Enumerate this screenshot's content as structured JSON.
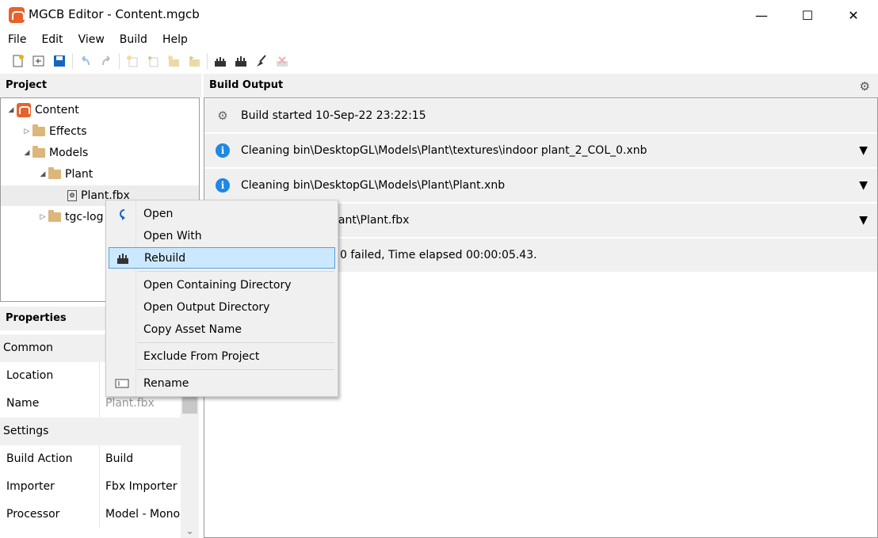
{
  "window": {
    "title": "MGCB Editor - Content.mgcb",
    "minimize": "—",
    "maximize": "☐",
    "close": "✕"
  },
  "menu": [
    "File",
    "Edit",
    "View",
    "Build",
    "Help"
  ],
  "toolbar": {
    "icons": [
      "new-icon",
      "open-icon",
      "save-icon",
      "undo-icon",
      "redo-icon",
      "new-item-icon",
      "add-item-icon",
      "new-folder-icon",
      "add-folder-icon",
      "build-icon",
      "rebuild-icon",
      "clean-icon",
      "cancel-build-icon"
    ]
  },
  "project": {
    "header": "Project",
    "tree": [
      {
        "label": "Content"
      },
      {
        "label": "Effects"
      },
      {
        "label": "Models"
      },
      {
        "label": "Plant"
      },
      {
        "label": "Plant.fbx"
      },
      {
        "label": "tgc-log"
      }
    ]
  },
  "properties": {
    "header": "Properties",
    "cat_common": "Common",
    "location": {
      "key": "Location",
      "value": ""
    },
    "name": {
      "key": "Name",
      "value": "Plant.fbx"
    },
    "cat_settings": "Settings",
    "build_action": {
      "key": "Build Action",
      "value": "Build"
    },
    "importer": {
      "key": "Importer",
      "value": "Fbx Importer -"
    },
    "processor": {
      "key": "Processor",
      "value": "Model - Mono"
    }
  },
  "output": {
    "header": "Build Output",
    "rows": [
      {
        "text": "Build started 10-Sep-22 23:22:15"
      },
      {
        "text": "Cleaning bin\\DesktopGL\\Models\\Plant\\textures\\indoor plant_2_COL_0.xnb"
      },
      {
        "text": "Cleaning bin\\DesktopGL\\Models\\Plant\\Plant.xnb"
      },
      {
        "text": "lant\\Plant.fbx"
      },
      {
        "text": "0 failed, Time elapsed 00:00:05.43."
      }
    ],
    "expander": "▼"
  },
  "context_menu": [
    {
      "label": "Open",
      "icon": "open-arrow-icon"
    },
    {
      "label": "Open With",
      "icon": ""
    },
    {
      "label": "Rebuild",
      "icon": "rebuild-icon"
    },
    {
      "label": "Open Containing Directory",
      "icon": ""
    },
    {
      "label": "Open Output Directory",
      "icon": ""
    },
    {
      "label": "Copy Asset Name",
      "icon": ""
    },
    {
      "label": "Exclude From Project",
      "icon": ""
    },
    {
      "label": "Rename",
      "icon": "rename-icon"
    }
  ],
  "colors": {
    "accent": "#e7612c",
    "selection": "#cce8ff",
    "info": "#1e88e5"
  }
}
